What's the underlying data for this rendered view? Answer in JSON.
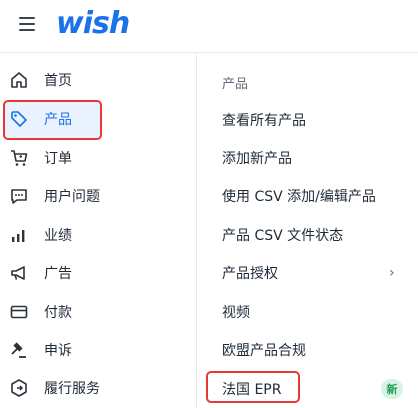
{
  "header": {
    "logo_text": "wish",
    "brand_color": "#1a73e8"
  },
  "sidebar": {
    "items": [
      {
        "label": "首页",
        "icon": "home-icon"
      },
      {
        "label": "产品",
        "icon": "tag-icon",
        "active": true
      },
      {
        "label": "订单",
        "icon": "cart-icon"
      },
      {
        "label": "用户问题",
        "icon": "chat-icon"
      },
      {
        "label": "业绩",
        "icon": "bar-chart-icon"
      },
      {
        "label": "广告",
        "icon": "megaphone-icon"
      },
      {
        "label": "付款",
        "icon": "credit-card-icon"
      },
      {
        "label": "申诉",
        "icon": "gavel-icon"
      },
      {
        "label": "履行服务",
        "icon": "fulfillment-icon"
      }
    ]
  },
  "submenu": {
    "header": "产品",
    "items": [
      {
        "label": "查看所有产品"
      },
      {
        "label": "添加新产品"
      },
      {
        "label": "使用 CSV 添加/编辑产品"
      },
      {
        "label": "产品 CSV 文件状态"
      },
      {
        "label": "产品授权",
        "chevron": "›"
      },
      {
        "label": "视频"
      },
      {
        "label": "欧盟产品合规"
      },
      {
        "label": "法国 EPR",
        "badge": "新"
      }
    ]
  },
  "colors": {
    "highlight_border": "#e53935",
    "active_bg": "#eaf2ff",
    "badge_bg": "#d8f3e3",
    "badge_text": "#1f9d55"
  }
}
